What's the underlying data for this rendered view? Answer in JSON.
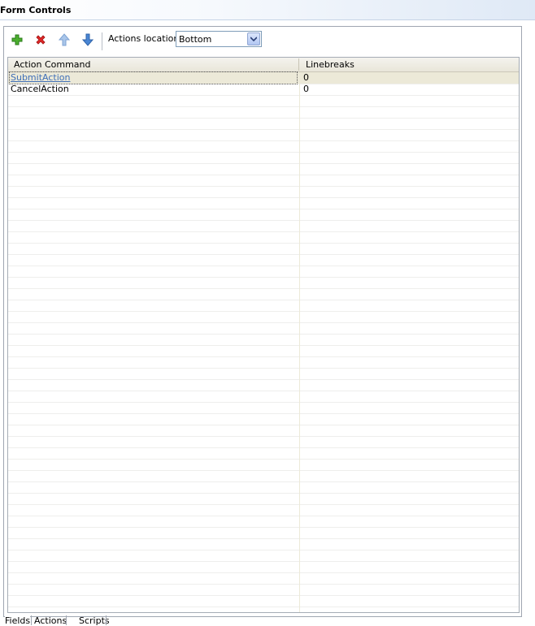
{
  "header": {
    "title": "Form Controls"
  },
  "toolbar": {
    "add_icon": "plus-icon",
    "remove_icon": "delete-x-icon",
    "up_icon": "arrow-up-icon",
    "down_icon": "arrow-down-icon",
    "location_label": "Actions location:",
    "location_value": "Bottom"
  },
  "table": {
    "columns": [
      "Action Command",
      "Linebreaks"
    ],
    "rows": [
      {
        "command": "SubmitAction",
        "linebreaks": "0",
        "selected": true
      },
      {
        "command": "CancelAction",
        "linebreaks": "0",
        "selected": false
      }
    ]
  },
  "tabs": [
    {
      "label": "Fields"
    },
    {
      "label": "Actions"
    },
    {
      "label": "Scripts"
    }
  ],
  "colors": {
    "selection": "#ece9d8",
    "link": "#3f6fb8",
    "add": "#3a9b2a",
    "remove": "#d42020",
    "arrow": "#4a86d4"
  }
}
